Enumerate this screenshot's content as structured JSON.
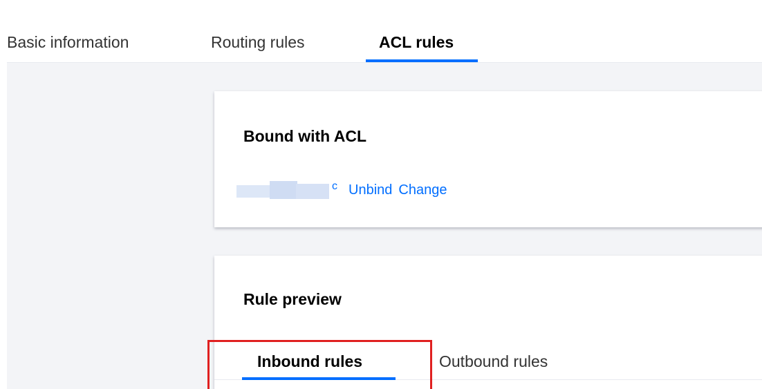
{
  "tabs": {
    "basic_information": "Basic information",
    "routing_rules": "Routing rules",
    "acl_rules": "ACL rules",
    "active": "ACL rules"
  },
  "bound_card": {
    "title": "Bound with ACL",
    "acl_name_visible_fragment": "c",
    "unbind_label": "Unbind",
    "change_label": "Change"
  },
  "preview_card": {
    "title": "Rule preview",
    "tabs": {
      "inbound": "Inbound rules",
      "outbound": "Outbound rules",
      "active": "Inbound rules"
    }
  },
  "colors": {
    "accent": "#006eff",
    "highlight": "#e02020",
    "background": "#f3f4f7"
  }
}
